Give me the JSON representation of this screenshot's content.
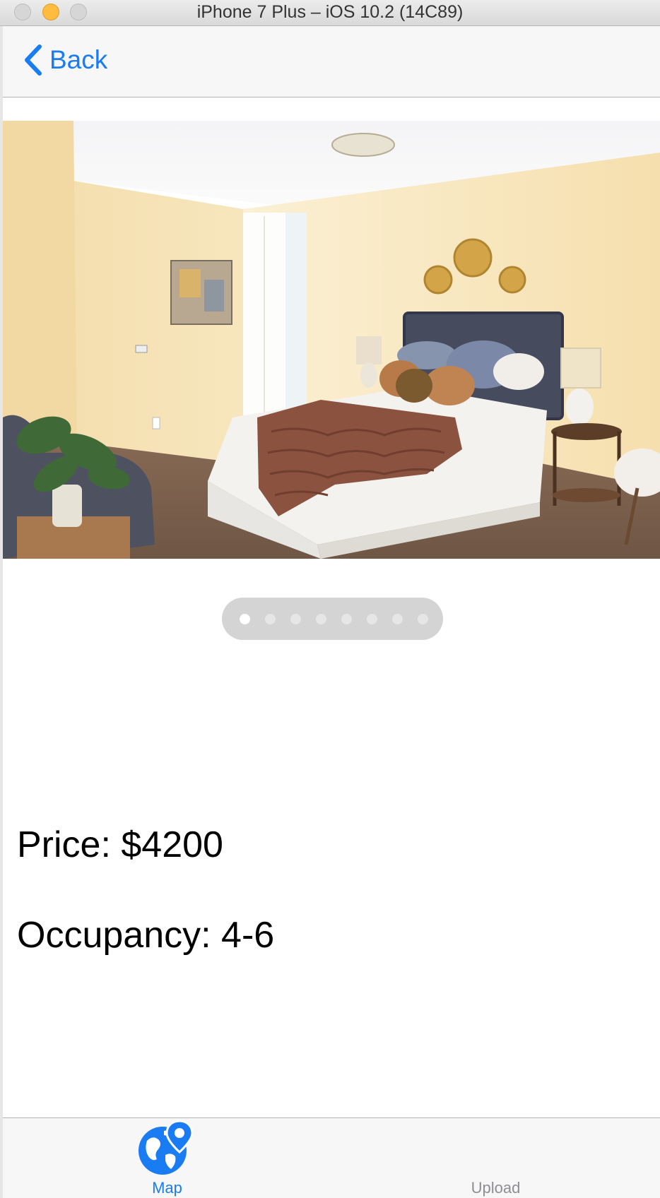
{
  "window": {
    "title": "iPhone 7 Plus – iOS 10.2 (14C89)"
  },
  "navbar": {
    "back_label": "Back"
  },
  "gallery": {
    "page_count": 8,
    "current_page": 1
  },
  "listing": {
    "price": "Price: $4200",
    "occupancy": "Occupancy: 4-6"
  },
  "tabbar": {
    "tabs": [
      {
        "label": "Map",
        "icon": "globe-pin-icon",
        "selected": true
      },
      {
        "label": "Upload",
        "selected": false
      }
    ]
  },
  "colors": {
    "tint": "#1a7cf3",
    "inactive_tab": "#8e8e93",
    "bar_background": "#f7f7f7"
  }
}
